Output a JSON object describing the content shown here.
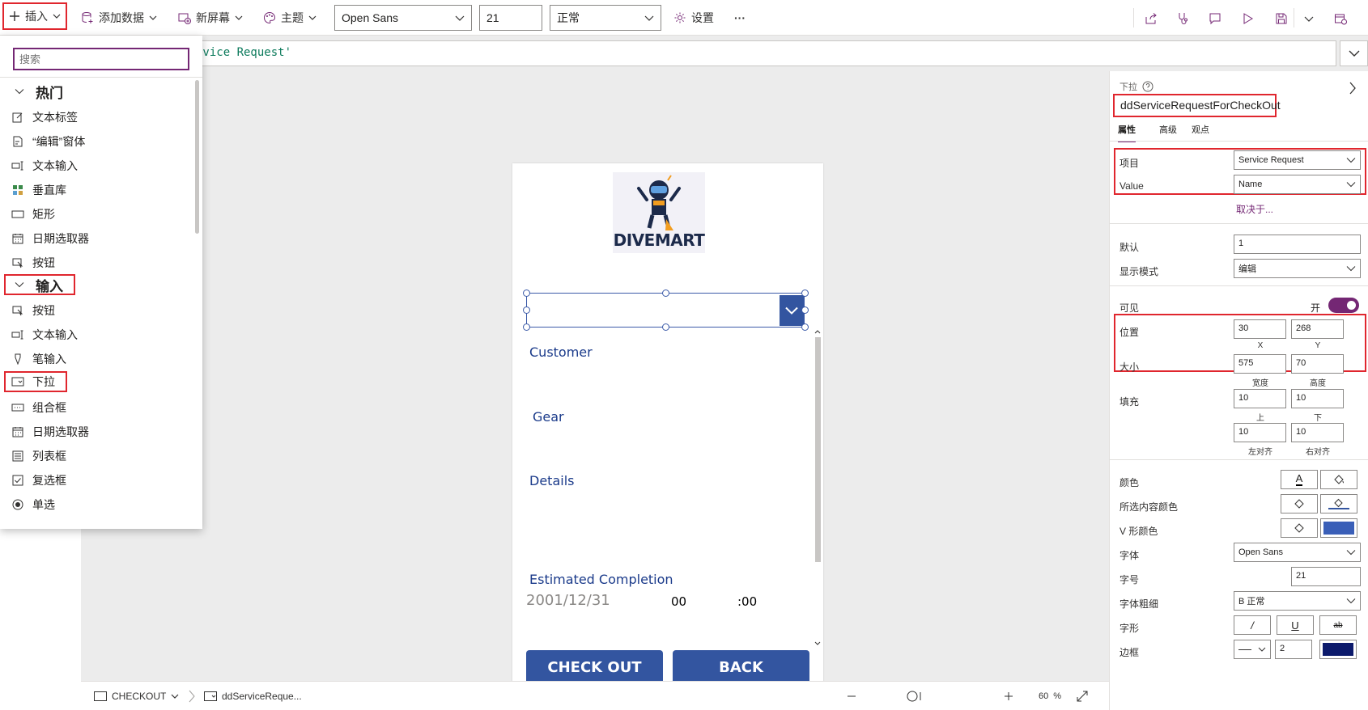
{
  "toolbar": {
    "insert": "插入",
    "add_data": "添加数据",
    "new_screen": "新屏幕",
    "theme": "主题",
    "font": "Open Sans",
    "font_size": "21",
    "font_weight": "正常",
    "settings": "设置",
    "more": "···"
  },
  "formula": {
    "text": "rvice Request'"
  },
  "insert_panel": {
    "search_placeholder": "搜索",
    "popular_header": "热门",
    "popular_items": [
      "文本标签",
      "“编辑”窗体",
      "文本输入",
      "垂直库",
      "矩形",
      "日期选取器",
      "按钮"
    ],
    "input_header": "输入",
    "input_items": [
      "按钮",
      "文本输入",
      "笔输入",
      "下拉",
      "组合框",
      "日期选取器",
      "列表框",
      "复选框",
      "单选"
    ]
  },
  "form": {
    "logo_text": "DIVEMART",
    "customer_label": "Customer",
    "gear_label": "Gear",
    "details_label": "Details",
    "estimated_label": "Estimated Completion",
    "date_value": "2001/12/31",
    "hour_value": "00",
    "minute_value": ":00",
    "checkout_button": "CHECK OUT",
    "back_button": "BACK"
  },
  "statusbar": {
    "screen_name": "CHECKOUT",
    "control_name": "ddServiceReque...",
    "zoom_value": "60",
    "zoom_unit": "%"
  },
  "properties": {
    "type_label": "下拉",
    "control_name": "ddServiceRequestForCheckOut",
    "tabs": [
      "属性",
      "高级",
      "观点"
    ],
    "items_label": "项目",
    "items_value": "Service Request",
    "value_label": "Value",
    "value_value": "Name",
    "depends_on": "取决于...",
    "default_label": "默认",
    "default_value": "1",
    "display_mode_label": "显示模式",
    "display_mode_value": "编辑",
    "visible_label": "可见",
    "visible_state": "开",
    "position_label": "位置",
    "pos_x": "30",
    "pos_y": "268",
    "x_caption": "X",
    "y_caption": "Y",
    "size_label": "大小",
    "width_value": "575",
    "height_value": "70",
    "width_caption": "宽度",
    "height_caption": "高度",
    "padding_label": "填充",
    "pad_top": "10",
    "pad_bottom": "10",
    "pad_left": "10",
    "pad_right": "10",
    "top_caption": "上",
    "bottom_caption": "下",
    "left_caption": "左对齐",
    "right_caption": "右对齐",
    "color_label": "颜色",
    "selection_color_label": "所选内容颜色",
    "chevron_color_label": "V 形颜色",
    "font_label": "字体",
    "font_value": "Open Sans",
    "size_font_label": "字号",
    "size_font_value": "21",
    "weight_label": "字体粗细",
    "weight_value": "B  正常",
    "style_label": "字形",
    "border_label": "边框",
    "border_width": "2",
    "color_text_glyph": "A",
    "italic_glyph": "/",
    "underline_glyph": "U",
    "strike_glyph": "ab"
  },
  "colors": {
    "accent_purple": "#742774",
    "brand_blue": "#3355a0",
    "highlight_red": "#e0262e",
    "chevron_fill": "#3a5fb8",
    "border_color": "#0c1a6b"
  }
}
